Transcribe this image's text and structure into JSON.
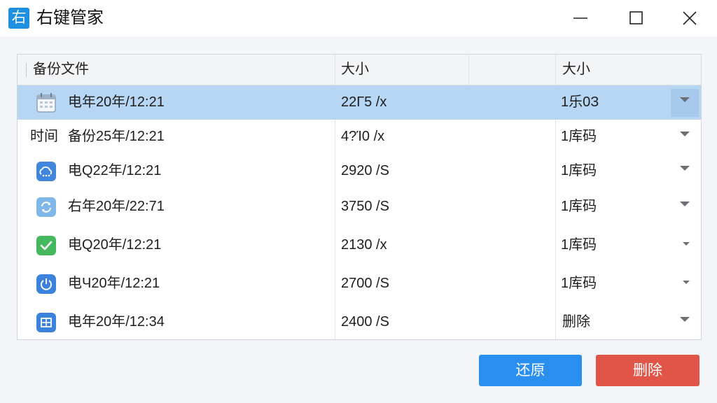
{
  "window": {
    "title": "右键管家",
    "app_icon_char": "右"
  },
  "columns": [
    "备份文件",
    "大小",
    "大小"
  ],
  "rows": [
    {
      "icon": "calendar-icon",
      "name": "电年20年/12:21",
      "size": "22Г5 /х",
      "status": "1乐0З",
      "selected": true
    },
    {
      "label": "时间",
      "name": "备份25年/12:21",
      "size": "4?Ί0 /х",
      "status": "1库码"
    },
    {
      "icon": "cloud-backup-icon",
      "name": "电Q22年/12:21",
      "size": "2920 /Ѕ",
      "status": "1库码"
    },
    {
      "icon": "sync-icon",
      "name": "右年20年/22:71",
      "size": "3750 /Ѕ",
      "status": "1库码"
    },
    {
      "icon": "check-icon",
      "name": "电Q20年/12:21",
      "size": "2130 /х",
      "status": "1库码"
    },
    {
      "icon": "power-icon",
      "name": "电Ч20年/12:21",
      "size": "2700 /Ѕ",
      "status": "1库码"
    },
    {
      "icon": "grid-icon",
      "name": "电年20年/12:34",
      "size": "2400 /Ѕ",
      "status": "删除"
    }
  ],
  "buttons": {
    "restore": "还原",
    "delete": "删除"
  },
  "colors": {
    "accent": "#2b8ff0",
    "danger": "#e05548",
    "selection": "#b7d6f4"
  }
}
